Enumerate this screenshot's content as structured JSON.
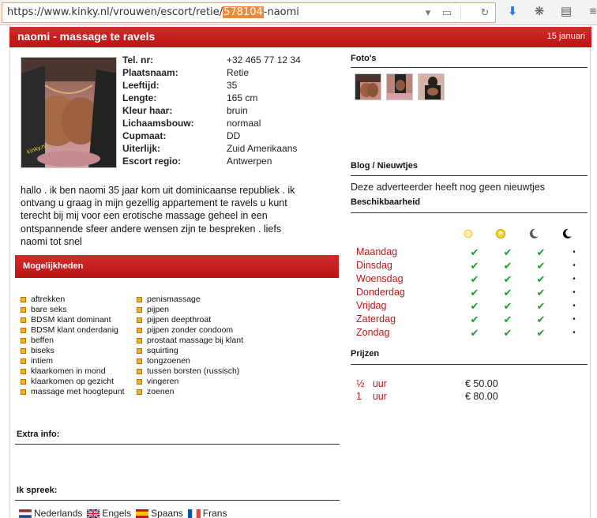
{
  "browser": {
    "url_prefix": "https://www.kinky.nl/vrouwen/escort/retie/",
    "url_highlight": "578104",
    "url_suffix": "-naomi"
  },
  "header": {
    "title": "naomi - massage te ravels",
    "date": "15 januari"
  },
  "profile": {
    "fields": [
      {
        "label": "Tel. nr:",
        "value": "+32 465 77 12 34"
      },
      {
        "label": "Plaatsnaam:",
        "value": "Retie"
      },
      {
        "label": "Leeftijd:",
        "value": "35"
      },
      {
        "label": "Lengte:",
        "value": "165 cm"
      },
      {
        "label": "Kleur haar:",
        "value": "bruin"
      },
      {
        "label": "Lichaamsbouw:",
        "value": "normaal"
      },
      {
        "label": "Cupmaat:",
        "value": "DD"
      },
      {
        "label": "Uiterlijk:",
        "value": "Zuid Amerikaans"
      },
      {
        "label": "Escort regio:",
        "value": "Antwerpen"
      }
    ],
    "bio": "hallo . ik ben naomi 35 jaar kom uit dominicaanse republiek . ik ontvang u graag in mijn gezellig appartement te ravels u kunt terecht bij mij voor een erotische massage geheel in een ontspannende sfeer andere wensen zijn te bespreken . liefs naomi tot snel"
  },
  "mogelijkheden": {
    "title": "Mogelijkheden",
    "col1": [
      "aftrekken",
      "bare seks",
      "BDSM klant dominant",
      "BDSM klant onderdanig",
      "beffen",
      "biseks",
      "intiem",
      "klaarkomen in mond",
      "klaarkomen op gezicht",
      "massage met hoogtepunt"
    ],
    "col2": [
      "penismassage",
      "pijpen",
      "pijpen deepthroat",
      "pijpen zonder condoom",
      "prostaat massage bij klant",
      "squirting",
      "tongzoenen",
      "tussen borsten (russisch)",
      "vingeren",
      "zoenen"
    ]
  },
  "extra_info": {
    "title": "Extra info:"
  },
  "languages": {
    "title": "Ik spreek:",
    "items": [
      {
        "name": "Nederlands",
        "flag": "nl-flag"
      },
      {
        "name": "Engels",
        "flag": "uk-flag"
      },
      {
        "name": "Spaans",
        "flag": "es-flag"
      },
      {
        "name": "Frans",
        "flag": "fr-flag"
      }
    ]
  },
  "photos": {
    "title": "Foto's"
  },
  "blog": {
    "title": "Blog / Nieuwtjes",
    "text": "Deze adverteerder heeft nog geen nieuwtjes"
  },
  "availability": {
    "title": "Beschikbaarheid",
    "periods": [
      "morning-sun-icon",
      "afternoon-sun-icon",
      "evening-moon-icon",
      "night-moon-icon"
    ],
    "days": [
      "Maandag",
      "Dinsdag",
      "Woensdag",
      "Donderdag",
      "Vrijdag",
      "Zaterdag",
      "Zondag"
    ],
    "check_mark": "✔",
    "dot_mark": "•"
  },
  "prices": {
    "title": "Prijzen",
    "items": [
      {
        "duration": "½   uur",
        "amount": "€ 50.00"
      },
      {
        "duration": "1    uur",
        "amount": "€ 80.00"
      }
    ]
  },
  "colors": {
    "accent": "#c41a1a",
    "check": "#1fa02c",
    "option_bullet": "#f6b21e"
  }
}
